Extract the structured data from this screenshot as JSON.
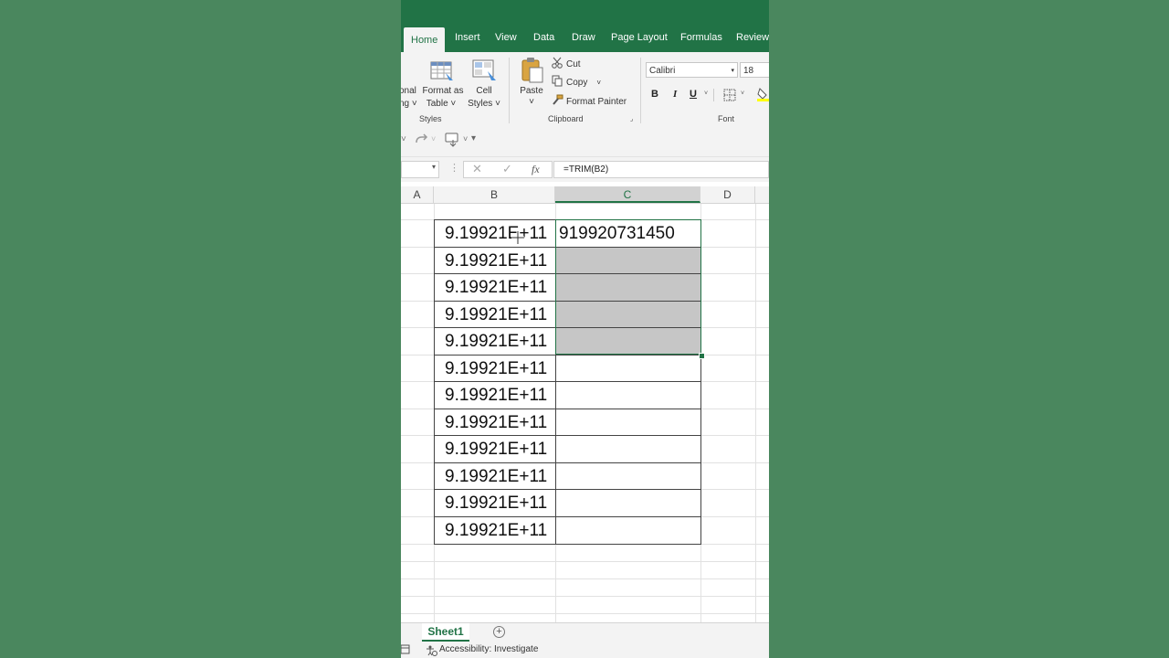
{
  "tabs": [
    {
      "label": "Home",
      "active": true
    },
    {
      "label": "Insert"
    },
    {
      "label": "View"
    },
    {
      "label": "Data"
    },
    {
      "label": "Draw"
    },
    {
      "label": "Page Layout"
    },
    {
      "label": "Formulas"
    },
    {
      "label": "Review"
    }
  ],
  "ribbon": {
    "styles": {
      "conditional_partial_1": "onal",
      "conditional_partial_2": "ng",
      "format_as_table_1": "Format as",
      "format_as_table_2": "Table",
      "cell_styles_1": "Cell",
      "cell_styles_2": "Styles",
      "group_label": "Styles"
    },
    "clipboard": {
      "paste": "Paste",
      "cut": "Cut",
      "copy": "Copy",
      "format_painter": "Format Painter",
      "group_label": "Clipboard"
    },
    "font": {
      "name": "Calibri",
      "size": "18",
      "bold": "B",
      "italic": "I",
      "underline": "U",
      "group_label": "Font"
    }
  },
  "formula_bar": {
    "fx": "fx",
    "formula": "=TRIM(B2)"
  },
  "columns": [
    "A",
    "B",
    "C",
    "D"
  ],
  "cells": {
    "b_values": [
      "9.19921E+11",
      "9.19921E+11",
      "9.19921E+11",
      "9.19921E+11",
      "9.19921E+11",
      "9.19921E+11",
      "9.19921E+11",
      "9.19921E+11",
      "9.19921E+11",
      "9.19921E+11",
      "9.19921E+11",
      "9.19921E+11"
    ],
    "c2_value": "919920731450"
  },
  "sheets": [
    "Sheet1"
  ],
  "status": {
    "accessibility": "Accessibility: Investigate"
  },
  "colors": {
    "excel_green": "#217346",
    "selection_fill": "#c6c6c6"
  }
}
